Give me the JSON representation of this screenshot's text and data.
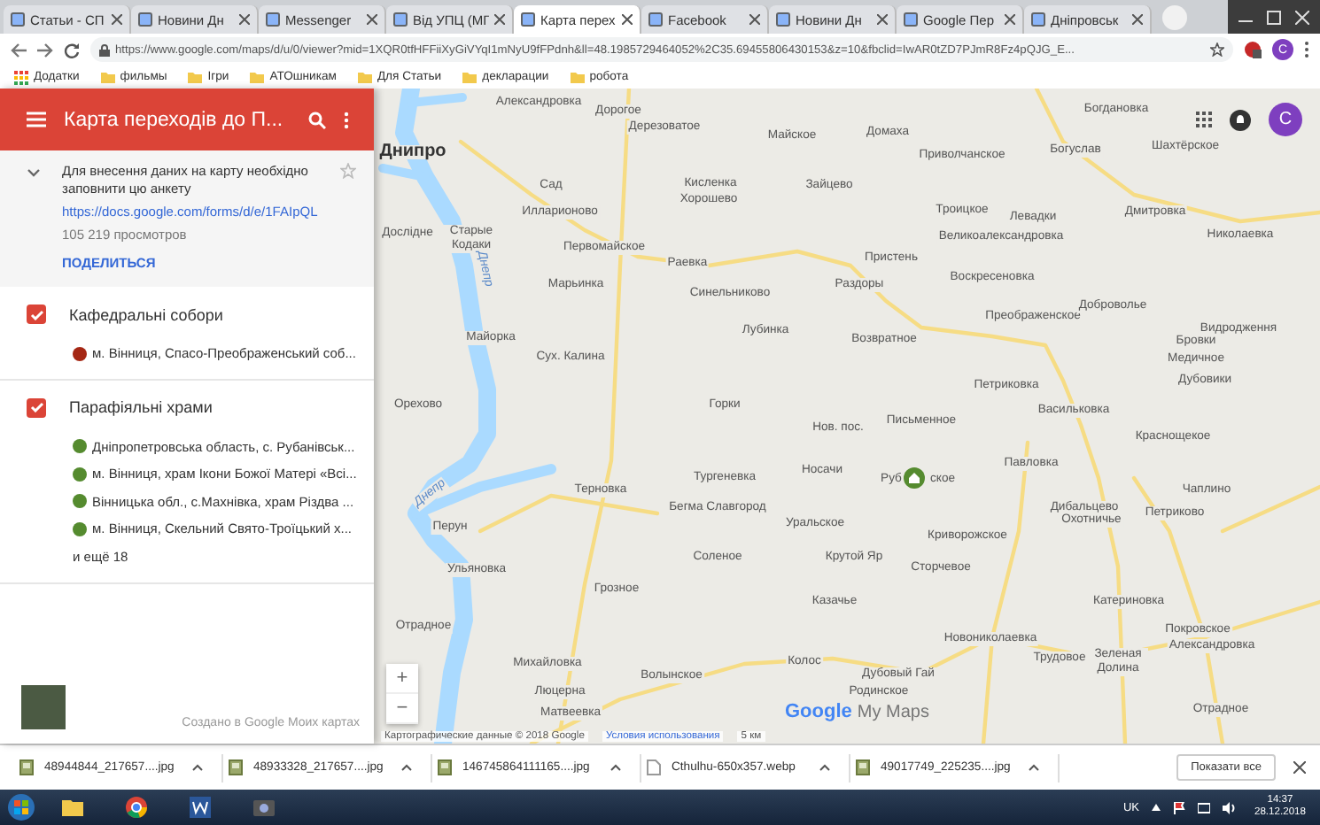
{
  "browser": {
    "tabs": [
      {
        "title": "Статьи - СП",
        "selected": false
      },
      {
        "title": "Новини Дн",
        "selected": false
      },
      {
        "title": "Messenger",
        "selected": false
      },
      {
        "title": "Від УПЦ (МГ",
        "selected": false
      },
      {
        "title": "Карта перех",
        "selected": true
      },
      {
        "title": "Facebook",
        "selected": false
      },
      {
        "title": "Новини Дн",
        "selected": false
      },
      {
        "title": "Google Пер",
        "selected": false
      },
      {
        "title": "Дніпровськ",
        "selected": false
      }
    ],
    "address": "https://www.google.com/maps/d/u/0/viewer?mid=1XQR0tfHFFiiXyGiVYqI1mNyU9fFPdnh&ll=48.1985729464052%2C35.69455806430153&z=10&fbclid=IwAR0tZD7PJmR8Fz4pQJG_E...",
    "profile": "C",
    "bookmarks": [
      "Додатки",
      "фильмы",
      "Ігри",
      "АТОшникам",
      "Для Статьи",
      "декларации",
      "робота"
    ]
  },
  "panel": {
    "title": "Карта переходів до П...",
    "description": "Для внесення даних на карту необхідно заповнити цю анкету",
    "link": "https://docs.google.com/forms/d/e/1FAIpQL",
    "views": "105 219 просмотров",
    "share": "ПОДЕЛИТЬСЯ",
    "layers": [
      {
        "name": "Кафедральні собори",
        "checked": true,
        "items": [
          {
            "text": "м. Вінниця, Спасо-Преображенський соб...",
            "color": "#a52714"
          }
        ]
      },
      {
        "name": "Парафіяльні храми",
        "checked": true,
        "items": [
          {
            "text": "Дніпропетровська область, с. Рубанівськ...",
            "color": "#558b2f"
          },
          {
            "text": "м. Вінниця, храм Ікони Божої Матері «Всі...",
            "color": "#558b2f"
          },
          {
            "text": "Вінницька обл., с.Махнівка, храм Різдва ...",
            "color": "#558b2f"
          },
          {
            "text": "м. Вінниця, Скельний Свято-Троїцький х...",
            "color": "#558b2f"
          }
        ],
        "more": "и ещё 18"
      }
    ],
    "footer": "Создано в Google Моих картах"
  },
  "map": {
    "places": [
      {
        "name": "Александровка",
        "kind": "village"
      },
      {
        "name": "Дорогое",
        "kind": "village"
      },
      {
        "name": "Богдановка",
        "kind": "village"
      },
      {
        "name": "Дерезоватое",
        "kind": "village"
      },
      {
        "name": "Майское",
        "kind": "village"
      },
      {
        "name": "Домаха",
        "kind": "village"
      },
      {
        "name": "Днипро",
        "kind": "city"
      },
      {
        "name": "Приволчанское",
        "kind": "village"
      },
      {
        "name": "Богуслав",
        "kind": "village"
      },
      {
        "name": "Шахтёрское",
        "kind": "village"
      },
      {
        "name": "Сад",
        "kind": "village"
      },
      {
        "name": "Кисленка",
        "kind": "village"
      },
      {
        "name": "Зайцево",
        "kind": "village"
      },
      {
        "name": "Илларионово",
        "kind": "village"
      },
      {
        "name": "Хорошево",
        "kind": "village"
      },
      {
        "name": "Троицкое",
        "kind": "village"
      },
      {
        "name": "Левадки",
        "kind": "village"
      },
      {
        "name": "Дмитровка",
        "kind": "village"
      },
      {
        "name": "Дослідне",
        "kind": "village"
      },
      {
        "name": "Старые Кодаки",
        "kind": "village"
      },
      {
        "name": "Днепр",
        "kind": "water"
      },
      {
        "name": "Первомайское",
        "kind": "village"
      },
      {
        "name": "Раевка",
        "kind": "village"
      },
      {
        "name": "Пристень",
        "kind": "village"
      },
      {
        "name": "Великоалександровка",
        "kind": "village"
      },
      {
        "name": "Николаевка",
        "kind": "village"
      },
      {
        "name": "Марьинка",
        "kind": "village"
      },
      {
        "name": "Синельниково",
        "kind": "village"
      },
      {
        "name": "Раздоры",
        "kind": "village"
      },
      {
        "name": "Воскресеновка",
        "kind": "village"
      },
      {
        "name": "Преображенское",
        "kind": "village"
      },
      {
        "name": "Доброволье",
        "kind": "village"
      },
      {
        "name": "Майорка",
        "kind": "village"
      },
      {
        "name": "Лубинка",
        "kind": "village"
      },
      {
        "name": "Возвратное",
        "kind": "village"
      },
      {
        "name": "Бровки",
        "kind": "village"
      },
      {
        "name": "Видродження",
        "kind": "village"
      },
      {
        "name": "Сух. Калина",
        "kind": "village"
      },
      {
        "name": "Медичное",
        "kind": "village"
      },
      {
        "name": "Петриковка",
        "kind": "village"
      },
      {
        "name": "Дубовики",
        "kind": "village"
      },
      {
        "name": "Орехово",
        "kind": "village"
      },
      {
        "name": "Горки",
        "kind": "village"
      },
      {
        "name": "Нов. пос.",
        "kind": "village"
      },
      {
        "name": "Письменное",
        "kind": "village"
      },
      {
        "name": "Васильковка",
        "kind": "village"
      },
      {
        "name": "Краснощекое",
        "kind": "village"
      },
      {
        "name": "Днепр",
        "kind": "water"
      },
      {
        "name": "Терновка",
        "kind": "village"
      },
      {
        "name": "Тургеневка",
        "kind": "village"
      },
      {
        "name": "Носачи",
        "kind": "village"
      },
      {
        "name": "Руб",
        "kind": "village"
      },
      {
        "name": "ское",
        "kind": "village"
      },
      {
        "name": "Павловка",
        "kind": "village"
      },
      {
        "name": "Чаплино",
        "kind": "village"
      },
      {
        "name": "Перун",
        "kind": "village"
      },
      {
        "name": "Бегма Славгород",
        "kind": "village"
      },
      {
        "name": "Уральское",
        "kind": "village"
      },
      {
        "name": "Криворожское",
        "kind": "village"
      },
      {
        "name": "Дибальцево",
        "kind": "village"
      },
      {
        "name": "Охотничье",
        "kind": "village"
      },
      {
        "name": "Петриково",
        "kind": "village"
      },
      {
        "name": "Ульяновка",
        "kind": "village"
      },
      {
        "name": "Соленое",
        "kind": "village"
      },
      {
        "name": "Крутой Яр",
        "kind": "village"
      },
      {
        "name": "Сторчевое",
        "kind": "village"
      },
      {
        "name": "Грозное",
        "kind": "village"
      },
      {
        "name": "Казачье",
        "kind": "village"
      },
      {
        "name": "Катериновка",
        "kind": "village"
      },
      {
        "name": "Отрадное",
        "kind": "village"
      },
      {
        "name": "Михайловка",
        "kind": "village"
      },
      {
        "name": "Волынское",
        "kind": "village"
      },
      {
        "name": "Колос",
        "kind": "village"
      },
      {
        "name": "Дубовый Гай",
        "kind": "village"
      },
      {
        "name": "Новониколаевка",
        "kind": "village"
      },
      {
        "name": "Трудовое",
        "kind": "village"
      },
      {
        "name": "Зеленая Долина",
        "kind": "village"
      },
      {
        "name": "Покровское",
        "kind": "village"
      },
      {
        "name": "Александровка",
        "kind": "village"
      },
      {
        "name": "Люцерна",
        "kind": "village"
      },
      {
        "name": "Матвеевка",
        "kind": "village"
      },
      {
        "name": "Родинское",
        "kind": "village"
      },
      {
        "name": "Отрадное",
        "kind": "village"
      }
    ],
    "account": "C",
    "zoom": [
      "+",
      "−"
    ],
    "logo": {
      "brand": "Google",
      "product": "My Maps"
    },
    "attribution": "Картографические данные © 2018 Google",
    "terms": "Условия использования",
    "scale": "5 км"
  },
  "downloads": {
    "files": [
      {
        "name": "48944844_217657....jpg",
        "kind": "image"
      },
      {
        "name": "48933328_217657....jpg",
        "kind": "image"
      },
      {
        "name": "146745864111165....jpg",
        "kind": "image"
      },
      {
        "name": "Cthulhu-650x357.webp",
        "kind": "document"
      },
      {
        "name": "49017749_225235....jpg",
        "kind": "image"
      }
    ],
    "show_all": "Показати все"
  },
  "taskbar": {
    "language": "UK",
    "time": "14:37",
    "date": "28.12.2018"
  }
}
